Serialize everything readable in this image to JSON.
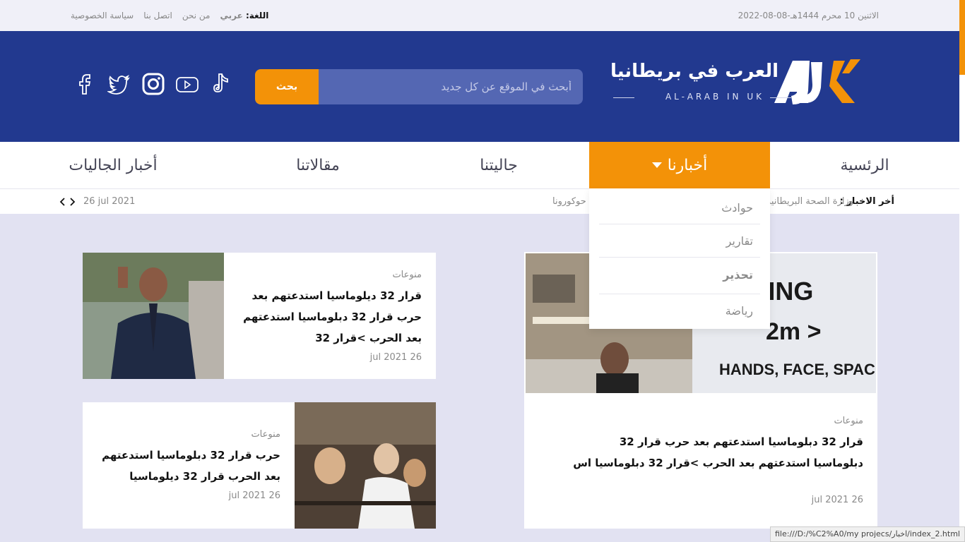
{
  "topbar": {
    "date": "الاثنين 10 محرم 1444هـ-08-08-2022",
    "lang_label": "اللغة:",
    "lang_value": "عربي",
    "about": "من نحن",
    "contact": "اتصل بنا",
    "privacy": "سياسة الخصوصية"
  },
  "header": {
    "logo_ar": "العرب في بريطانيا",
    "logo_en": "AL-ARAB IN UK",
    "search_placeholder": "أبحث في الموقع عن كل جديد",
    "search_button": "بحث",
    "social": [
      "facebook-icon",
      "twitter-icon",
      "instagram-icon",
      "youtube-icon",
      "tiktok-icon"
    ],
    "brand_color": "#22398f",
    "accent_color": "#f39208"
  },
  "nav": {
    "home": "الرئسية",
    "news": "أخبارنا",
    "community": "جاليتنا",
    "articles": "مقالاتنا",
    "community_news": "أخبار الجاليات"
  },
  "dropdown": {
    "items": [
      "حوادث",
      "تقارير",
      "تحذير",
      "رياضة"
    ]
  },
  "ticker": {
    "label": "أخر الاخبار :",
    "text1": "وزارة الصحة البريطانية",
    "text2": "حوكورونا",
    "date": "26 jul 2021"
  },
  "cards": {
    "big": {
      "category": "منوعات",
      "title": "قرار 32 دبلوماسيا استدعتهم بعد حرب قرار 32 دبلوماسيا استدعتهم بعد الحرب >قرار 32 دبلوماسيا اس",
      "date": "26 jul 2021"
    },
    "small1": {
      "category": "منوعات",
      "title": "قرار 32 ديلوماسيا استدعتهم بعد حرب قرار 32 دبلوماسيا استدعتهم بعد الحرب >قرار 32",
      "date": "26 jul 2021"
    },
    "small2": {
      "category": "منوعات",
      "title": "حرب قرار 32 دبلوماسيا استدعتهم بعد الحرب قرار 32 ديلوماسيا",
      "date": "26 jul 2021"
    }
  },
  "statusbar": {
    "url": "file:///D:/%C2%A0/my projecs/اخبار/index_2.html"
  }
}
